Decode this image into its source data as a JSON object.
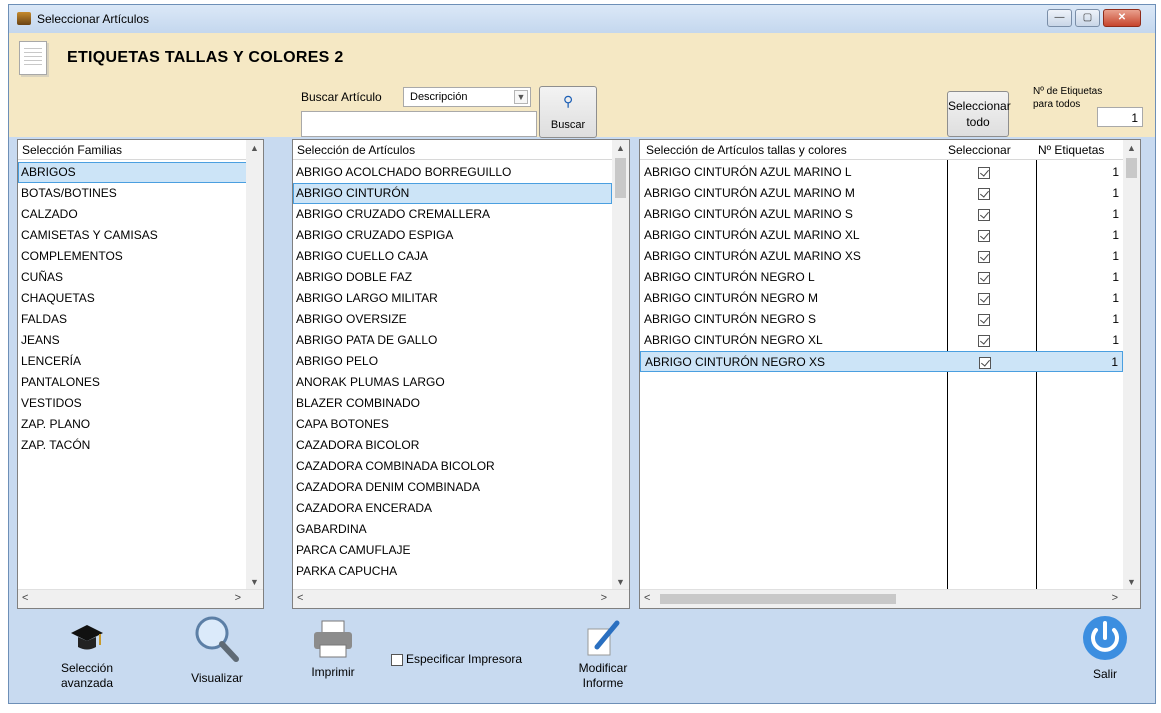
{
  "window": {
    "title": "Seleccionar Artículos",
    "app_title": "ETIQUETAS TALLAS Y COLORES 2",
    "controls": [
      "—",
      "▢",
      "✕"
    ]
  },
  "search": {
    "label": "Buscar Artículo",
    "mode": "Descripción",
    "query": "",
    "button_label": "Buscar"
  },
  "select_all": {
    "label_line1": "Seleccionar",
    "label_line2": "todo",
    "count_label_line1": "Nº de Etiquetas",
    "count_label_line2": "para todos",
    "count_value": "1"
  },
  "families": {
    "header": "Selección Familias",
    "selected_index": 0,
    "items": [
      "ABRIGOS",
      "BOTAS/BOTINES",
      "CALZADO",
      "CAMISETAS Y CAMISAS",
      "COMPLEMENTOS",
      "CUÑAS",
      "CHAQUETAS",
      "FALDAS",
      "JEANS",
      "LENCERÍA",
      "PANTALONES",
      "VESTIDOS",
      "ZAP. PLANO",
      "ZAP. TACÓN"
    ]
  },
  "articles": {
    "header": "Selección de Artículos",
    "selected_index": 1,
    "items": [
      "ABRIGO ACOLCHADO BORREGUILLO",
      "ABRIGO CINTURÓN",
      "ABRIGO CRUZADO CREMALLERA",
      "ABRIGO CRUZADO ESPIGA",
      "ABRIGO CUELLO CAJA",
      "ABRIGO DOBLE FAZ",
      "ABRIGO LARGO MILITAR",
      "ABRIGO OVERSIZE",
      "ABRIGO PATA DE GALLO",
      "ABRIGO PELO",
      "ANORAK PLUMAS LARGO",
      "BLAZER COMBINADO",
      "CAPA BOTONES",
      "CAZADORA BICOLOR",
      "CAZADORA COMBINADA BICOLOR",
      "CAZADORA DENIM COMBINADA",
      "CAZADORA ENCERADA",
      "GABARDINA",
      "PARCA CAMUFLAJE",
      "PARKA CAPUCHA"
    ]
  },
  "variants": {
    "header_name": "Selección de Artículos tallas y colores",
    "header_select": "Seleccionar",
    "header_count": "Nº Etiquetas",
    "selected_index": 9,
    "rows": [
      {
        "name": "ABRIGO CINTURÓN AZUL MARINO L",
        "checked": true,
        "count": "1"
      },
      {
        "name": "ABRIGO CINTURÓN AZUL MARINO M",
        "checked": true,
        "count": "1"
      },
      {
        "name": "ABRIGO CINTURÓN AZUL MARINO S",
        "checked": true,
        "count": "1"
      },
      {
        "name": "ABRIGO CINTURÓN AZUL MARINO XL",
        "checked": true,
        "count": "1"
      },
      {
        "name": "ABRIGO CINTURÓN AZUL MARINO XS",
        "checked": true,
        "count": "1"
      },
      {
        "name": "ABRIGO CINTURÓN NEGRO L",
        "checked": true,
        "count": "1"
      },
      {
        "name": "ABRIGO CINTURÓN NEGRO M",
        "checked": true,
        "count": "1"
      },
      {
        "name": "ABRIGO CINTURÓN NEGRO S",
        "checked": true,
        "count": "1"
      },
      {
        "name": "ABRIGO CINTURÓN NEGRO XL",
        "checked": true,
        "count": "1"
      },
      {
        "name": "ABRIGO CINTURÓN NEGRO XS",
        "checked": true,
        "count": "1"
      }
    ]
  },
  "toolbar": {
    "advanced_line1": "Selección",
    "advanced_line2": "avanzada",
    "preview": "Visualizar",
    "print": "Imprimir",
    "specify_printer": "Especificar Impresora",
    "modify_line1": "Modificar",
    "modify_line2": "Informe",
    "exit": "Salir"
  },
  "colors": {
    "selection_bg": "#cce4f7",
    "selection_border": "#4a9fe0",
    "header_bg": "#f5e8c4",
    "client_bg": "#c8daf0"
  }
}
